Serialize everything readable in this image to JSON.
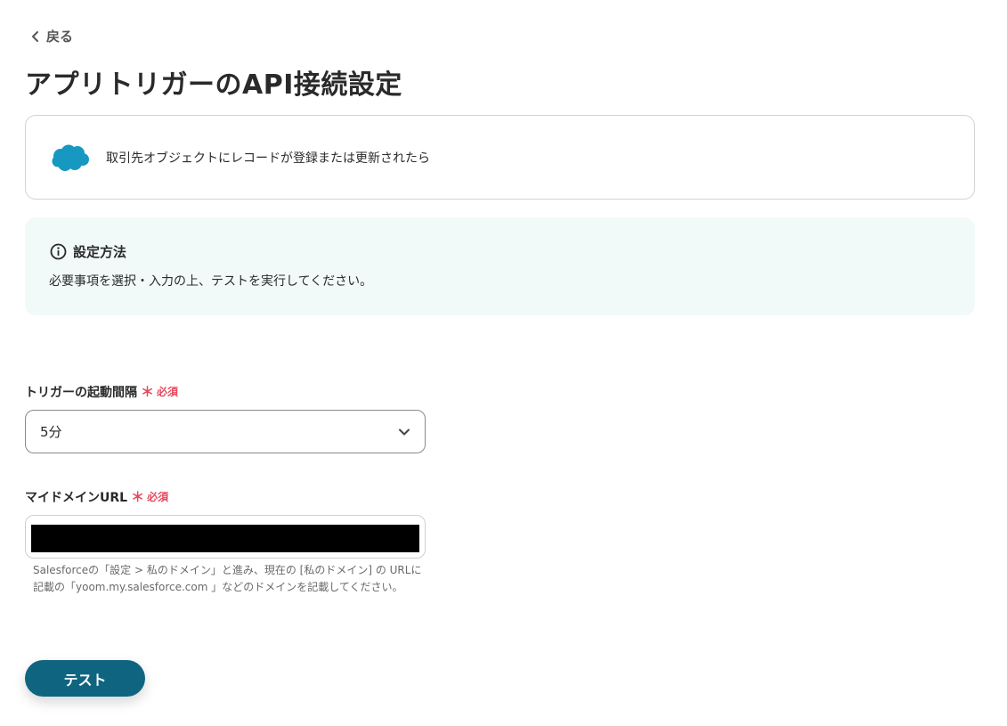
{
  "nav": {
    "back_label": "戻る"
  },
  "page": {
    "title": "アプリトリガーのAPI接続設定"
  },
  "trigger": {
    "app_icon": "salesforce-logo",
    "description": "取引先オブジェクトにレコードが登録または更新されたら"
  },
  "info": {
    "icon": "info-icon",
    "heading": "設定方法",
    "body": "必要事項を選択・入力の上、テストを実行してください。"
  },
  "fields": {
    "interval": {
      "label": "トリガーの起動間隔",
      "required_mark": "＊",
      "required_text": "必須",
      "selected_value": "5分"
    },
    "domain_url": {
      "label": "マイドメインURL",
      "required_mark": "＊",
      "required_text": "必須",
      "value": "",
      "help_line1": "Salesforceの「設定 > 私のドメイン」と進み、現在の [私のドメイン] の URLに",
      "help_line2": "記載の「yoom.my.salesforce.com 」などのドメインを記載してください。"
    }
  },
  "actions": {
    "test_label": "テスト"
  },
  "colors": {
    "primary_button": "#0f6580",
    "required": "#e5485d",
    "info_bg": "#f1faf9",
    "salesforce_blue": "#1798c1"
  }
}
